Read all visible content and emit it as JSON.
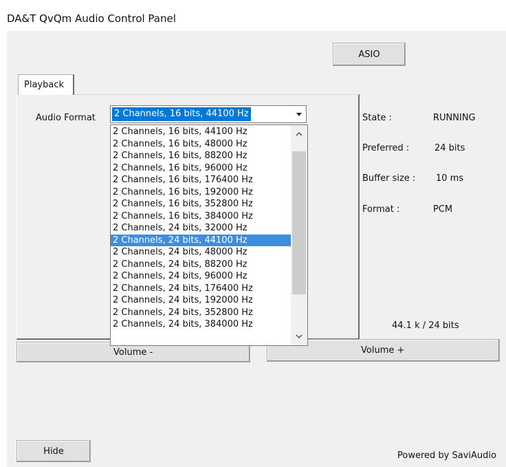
{
  "window": {
    "title": "DA&T QvQm Audio Control Panel"
  },
  "buttons": {
    "asio": "ASIO",
    "hide": "Hide",
    "volume_minus": "Volume -",
    "volume_plus": "Volume +"
  },
  "tabs": [
    {
      "label": "Playback"
    }
  ],
  "audio_format": {
    "label": "Audio Format",
    "value": "2 Channels, 16 bits, 44100 Hz",
    "options": [
      "2 Channels, 16 bits, 44100 Hz",
      "2 Channels, 16 bits, 48000 Hz",
      "2 Channels, 16 bits, 88200 Hz",
      "2 Channels, 16 bits, 96000 Hz",
      "2 Channels, 16 bits, 176400 Hz",
      "2 Channels, 16 bits, 192000 Hz",
      "2 Channels, 16 bits, 352800 Hz",
      "2 Channels, 16 bits, 384000 Hz",
      "2 Channels, 24 bits, 32000 Hz",
      "2 Channels, 24 bits, 44100 Hz",
      "2 Channels, 24 bits, 48000 Hz",
      "2 Channels, 24 bits, 88200 Hz",
      "2 Channels, 24 bits, 96000 Hz",
      "2 Channels, 24 bits, 176400 Hz",
      "2 Channels, 24 bits, 192000 Hz",
      "2 Channels, 24 bits, 352800 Hz",
      "2 Channels, 24 bits, 384000 Hz"
    ],
    "highlighted": "2 Channels, 24 bits, 44100 Hz"
  },
  "status": {
    "state_label": "State :",
    "state_value": "RUNNING",
    "preferred_label": "Preferred :",
    "preferred_value": "24 bits",
    "buffer_label": "Buffer size :",
    "buffer_value": "10 ms",
    "format_label": "Format :",
    "format_value": "PCM",
    "summary": "44.1 k / 24 bits"
  },
  "footer": {
    "powered_by": "Powered by SaviAudio"
  },
  "colors": {
    "selection": "#0078d7",
    "highlight": "#3d8ee0",
    "panel_bg": "#f0f0f0"
  }
}
